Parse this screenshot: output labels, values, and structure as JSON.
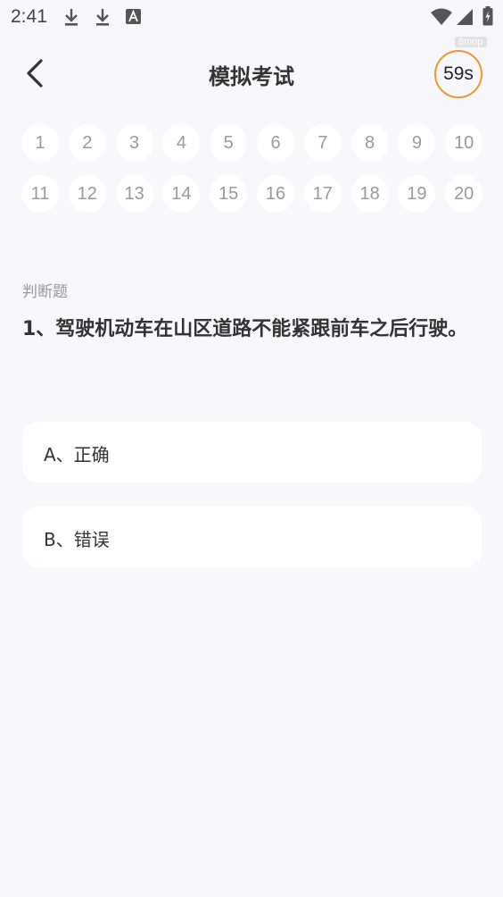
{
  "status_bar": {
    "time": "2:41"
  },
  "header": {
    "title": "模拟考试",
    "timer": "59s",
    "watermark": "8mop"
  },
  "questions": [
    "1",
    "2",
    "3",
    "4",
    "5",
    "6",
    "7",
    "8",
    "9",
    "10",
    "11",
    "12",
    "13",
    "14",
    "15",
    "16",
    "17",
    "18",
    "19",
    "20"
  ],
  "question": {
    "type": "判断题",
    "text": "1、驾驶机动车在山区道路不能紧跟前车之后行驶。",
    "options": [
      {
        "label": "A、正确"
      },
      {
        "label": "B、错误"
      }
    ]
  },
  "colors": {
    "accent": "#f5952e",
    "background": "#f7f8fb"
  },
  "icons": [
    "download-icon",
    "download-icon",
    "font-app-icon",
    "wifi-icon",
    "signal-icon",
    "battery-icon",
    "back-arrow-icon"
  ]
}
